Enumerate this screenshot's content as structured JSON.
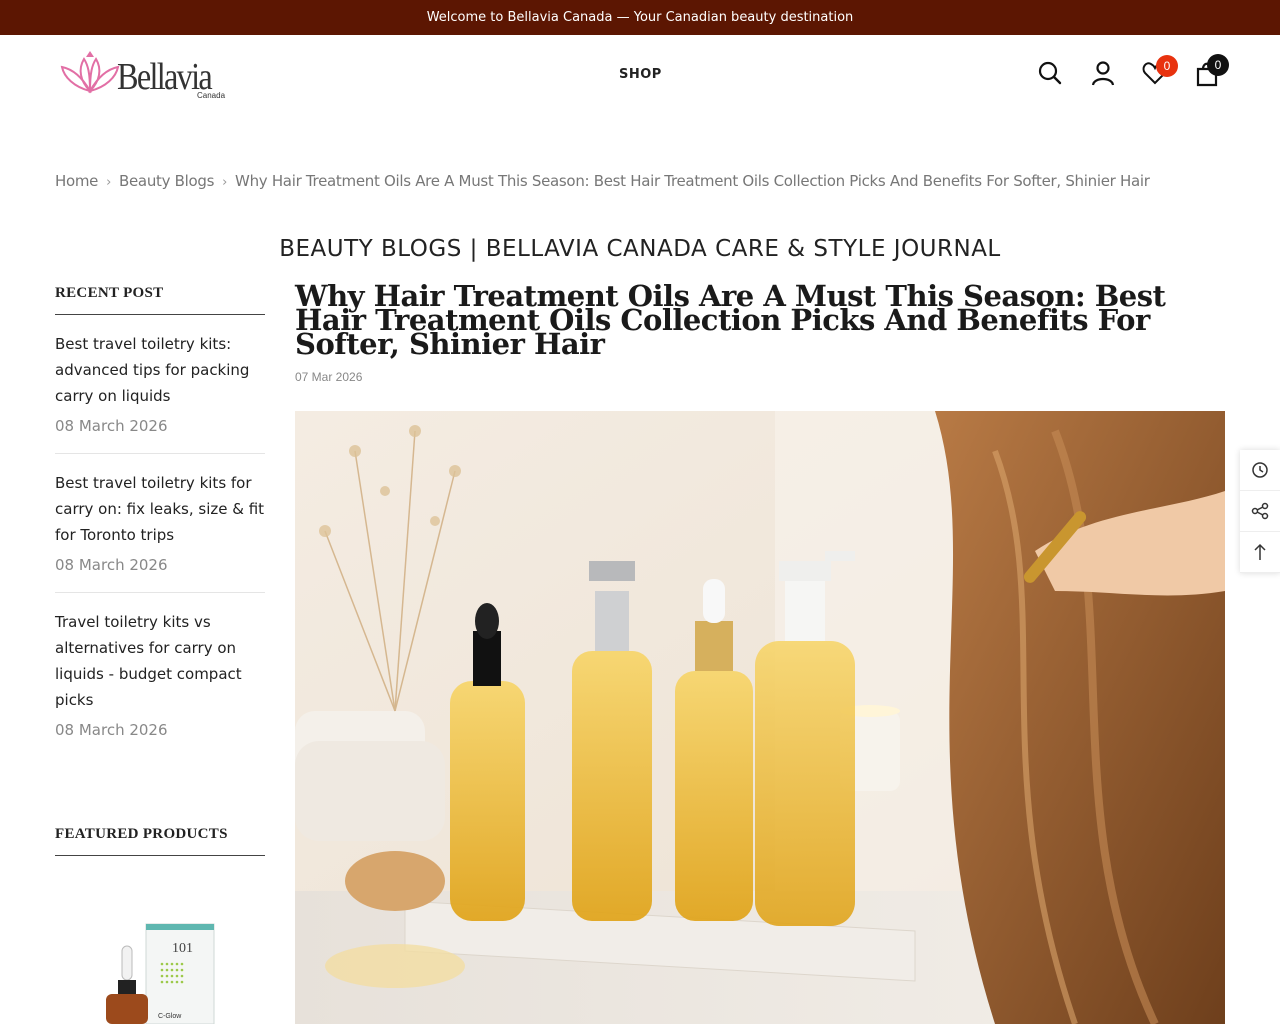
{
  "announcement": "Welcome to Bellavia Canada — Your Canadian beauty destination",
  "logo": {
    "name": "Bellavia",
    "sub": "Canada"
  },
  "nav": {
    "shop": "SHOP"
  },
  "header": {
    "wishlist_count": "0",
    "cart_count": "0"
  },
  "breadcrumb": {
    "home": "Home",
    "blogs": "Beauty Blogs",
    "current": "Why Hair Treatment Oils Are A Must This Season: Best Hair Treatment Oils Collection Picks And Benefits For Softer, Shinier Hair"
  },
  "blog_heading": "BEAUTY BLOGS | BELLAVIA CANADA CARE & STYLE JOURNAL",
  "sidebar": {
    "recent_title": "RECENT POST",
    "posts": [
      {
        "title": "Best travel toiletry kits: advanced tips for packing carry on liquids",
        "date": "08 March 2026"
      },
      {
        "title": "Best travel toiletry kits for carry on: fix leaks, size & fit for Toronto trips",
        "date": "08 March 2026"
      },
      {
        "title": "Travel toiletry kits vs alternatives for carry on liquids - budget compact picks",
        "date": "08 March 2026"
      }
    ],
    "featured_title": "FEATURED PRODUCTS",
    "product_label": "C-Glow"
  },
  "article": {
    "title": "Why Hair Treatment Oils Are A Must This Season: Best Hair Treatment Oils Collection Picks And Benefits For Softer, Shinier Hair",
    "date": "07 Mar 2026"
  },
  "colors": {
    "announcement_bg": "#5c1602",
    "badge": "#e8320f",
    "cart_badge": "#111111"
  }
}
